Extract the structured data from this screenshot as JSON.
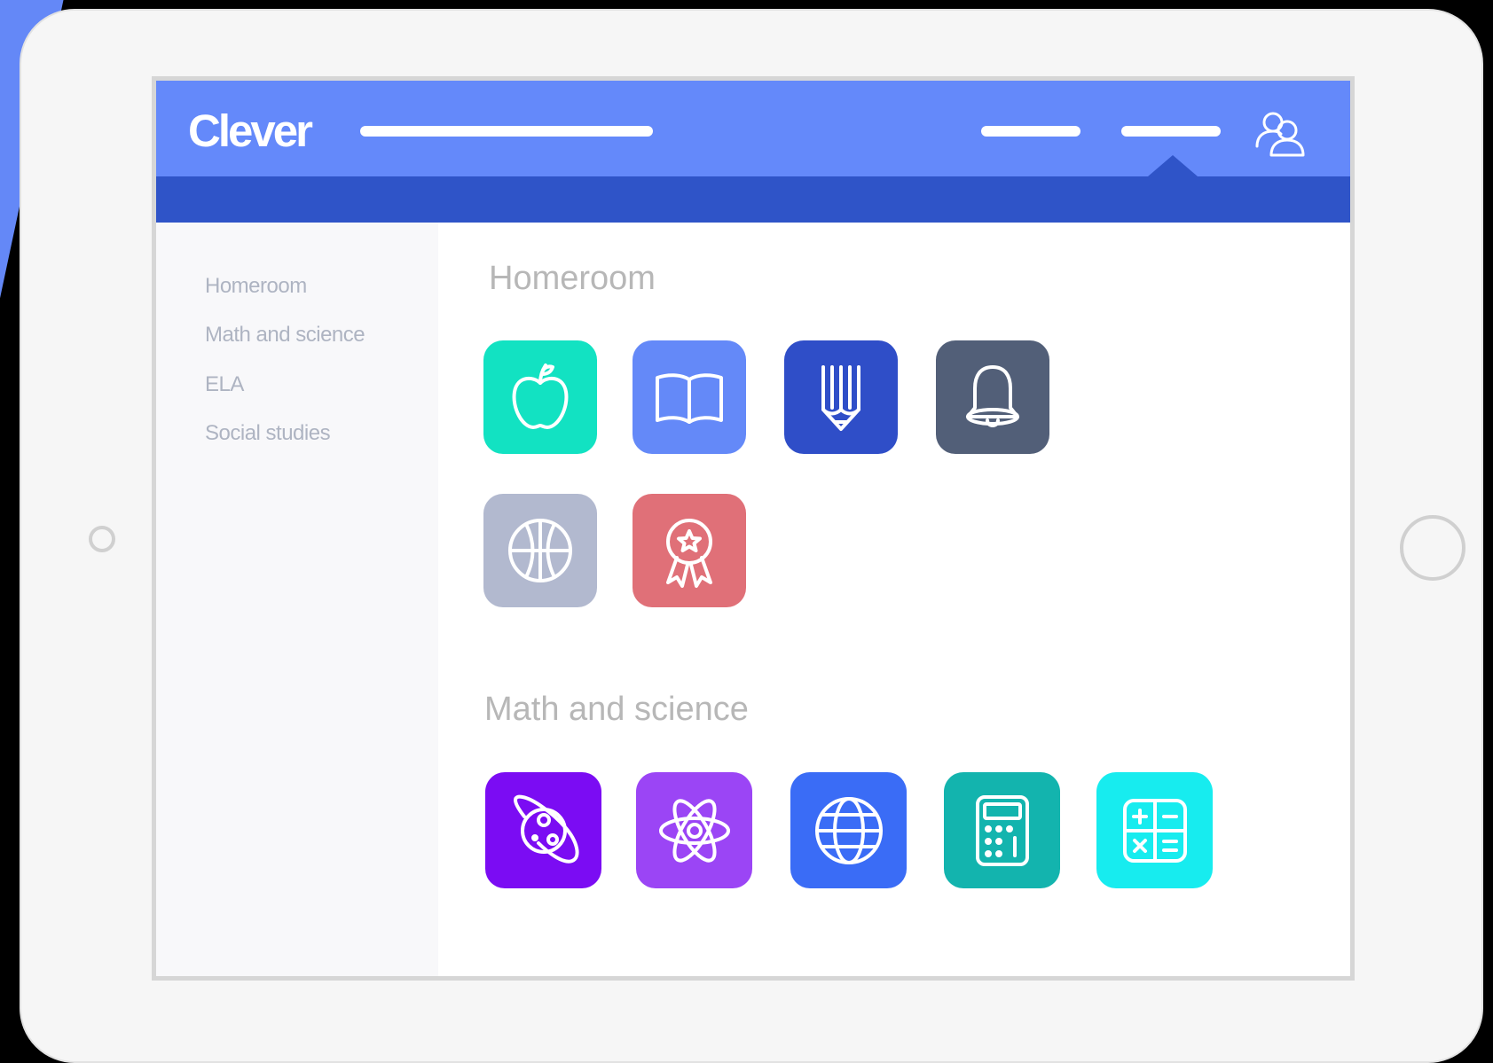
{
  "brand": {
    "name": "Clever"
  },
  "colors": {
    "header": "#6489fa",
    "subheader": "#2f54c8",
    "sidebar_text": "#aeb4c2",
    "section_title": "#b7b7b7"
  },
  "sidebar": {
    "items": [
      {
        "label": "Homeroom"
      },
      {
        "label": "Math and science"
      },
      {
        "label": "ELA"
      },
      {
        "label": "Social studies"
      }
    ]
  },
  "sections": [
    {
      "title": "Homeroom",
      "apps": [
        {
          "icon": "apple-icon",
          "color": "#12e2c2"
        },
        {
          "icon": "book-icon",
          "color": "#6489f8"
        },
        {
          "icon": "pencil-icon",
          "color": "#2f4ec8"
        },
        {
          "icon": "bell-icon",
          "color": "#525f78"
        },
        {
          "icon": "basketball-icon",
          "color": "#b2b9cf"
        },
        {
          "icon": "award-ribbon-icon",
          "color": "#e07078"
        }
      ]
    },
    {
      "title": "Math and science",
      "apps": [
        {
          "icon": "planet-icon",
          "color": "#7b0cf3"
        },
        {
          "icon": "atom-icon",
          "color": "#9b45f5"
        },
        {
          "icon": "globe-icon",
          "color": "#3a6cf6"
        },
        {
          "icon": "calculator-icon",
          "color": "#13b4ae"
        },
        {
          "icon": "math-operations-icon",
          "color": "#17ecef"
        }
      ]
    }
  ]
}
